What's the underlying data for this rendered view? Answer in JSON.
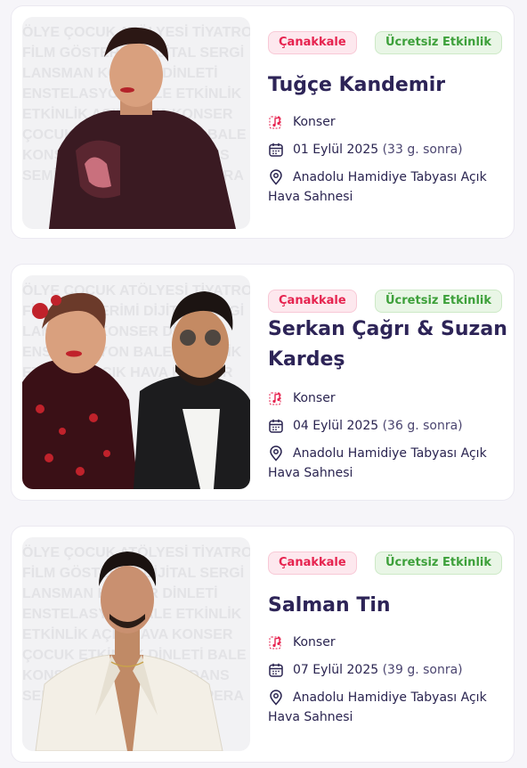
{
  "events": [
    {
      "city": "Çanakkale",
      "price_tag": "Ücretsiz Etkinlik",
      "title": "Tuğçe Kandemir",
      "category": "Konser",
      "date": "01 Eylül 2025",
      "relative": "(33 g. sonra)",
      "venue_line1": "Anadolu Hamidiye Tabyası Açık",
      "venue_line2": "Hava Sahnesi"
    },
    {
      "city": "Çanakkale",
      "price_tag": "Ücretsiz Etkinlik",
      "title": "Serkan Çağrı & Suzan Kardeş",
      "category": "Konser",
      "date": "04 Eylül 2025",
      "relative": "(36 g. sonra)",
      "venue_line1": "Anadolu Hamidiye Tabyası Açık",
      "venue_line2": "Hava Sahnesi"
    },
    {
      "city": "Çanakkale",
      "price_tag": "Ücretsiz Etkinlik",
      "title": "Salman Tin",
      "category": "Konser",
      "date": "07 Eylül 2025",
      "relative": "(39 g. sonra)",
      "venue_line1": "Anadolu Hamidiye Tabyası Açık",
      "venue_line2": "Hava Sahnesi"
    }
  ],
  "background_words": "ÖLYE ÇOCUK ATÖLYESİ TİYATRO FİLM GÖSTERİMİ DİJİTAL SERGİ LANSMAN KONSER DİNLETİ ENSTELASYON BALE ETKİNLİK AÇIK HAVA ÖDÜL TÖRENİ SEMİNER GASTRONOMİ OPERA",
  "colors": {
    "title": "#2d2457",
    "city_tag": "#e6234f",
    "free_tag": "#3da03a"
  },
  "icons": [
    "music-note-icon",
    "calendar-icon",
    "location-pin-icon"
  ]
}
